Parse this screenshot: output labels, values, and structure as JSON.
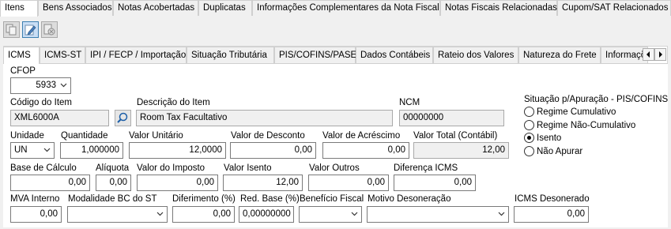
{
  "top_tabs": [
    {
      "label": "Itens",
      "active": true
    },
    {
      "label": "Bens Associados"
    },
    {
      "label": "Notas Acobertadas"
    },
    {
      "label": "Duplicatas"
    },
    {
      "label": "Informações Complementares da Nota Fiscal"
    },
    {
      "label": "Notas Fiscais Relacionadas"
    },
    {
      "label": "Cupom/SAT Relacionados"
    }
  ],
  "toolbar": {
    "buttons": [
      "copy-icon",
      "edit-icon",
      "delete-icon"
    ]
  },
  "inner_tabs": [
    {
      "label": "ICMS",
      "active": true
    },
    {
      "label": "ICMS-ST"
    },
    {
      "label": "IPI / FECP / Importação"
    },
    {
      "label": "Situação Tributária"
    },
    {
      "label": "PIS/COFINS/PASEP"
    },
    {
      "label": "Dados Contábeis"
    },
    {
      "label": "Rateio dos Valores"
    },
    {
      "label": "Natureza do Frete"
    },
    {
      "label": "Informações"
    }
  ],
  "form": {
    "cfop": {
      "label": "CFOP",
      "value": "5933"
    },
    "codigo_item": {
      "label": "Código do Item",
      "value": "XML6000A"
    },
    "descricao_item": {
      "label": "Descrição do Item",
      "value": "Room Tax Facultativo"
    },
    "ncm": {
      "label": "NCM",
      "value": "00000000"
    },
    "unidade": {
      "label": "Unidade",
      "value": "UN"
    },
    "quantidade": {
      "label": "Quantidade",
      "value": "1,000000"
    },
    "valor_unitario": {
      "label": "Valor Unitário",
      "value": "12,0000"
    },
    "valor_desconto": {
      "label": "Valor de Desconto",
      "value": "0,00"
    },
    "valor_acrescimo": {
      "label": "Valor de Acréscimo",
      "value": "0,00"
    },
    "valor_total": {
      "label": "Valor Total (Contábil)",
      "value": "12,00"
    },
    "base_calculo": {
      "label": "Base de Cálculo",
      "value": "0,00"
    },
    "aliquota": {
      "label": "Alíquota",
      "value": "0,00"
    },
    "valor_imposto": {
      "label": "Valor do Imposto",
      "value": "0,00"
    },
    "valor_isento": {
      "label": "Valor Isento",
      "value": "12,00"
    },
    "valor_outros": {
      "label": "Valor Outros",
      "value": "0,00"
    },
    "diferenca_icms": {
      "label": "Diferença ICMS",
      "value": "0,00"
    },
    "mva_interno": {
      "label": "MVA Interno",
      "value": "0,00"
    },
    "modalidade_bc": {
      "label": "Modalidade BC do ST",
      "value": ""
    },
    "diferimento": {
      "label": "Diferimento (%)",
      "value": "0,00"
    },
    "red_base": {
      "label": "Red. Base (%)",
      "value": "0,00000000"
    },
    "beneficio_fiscal": {
      "label": "Benefício Fiscal",
      "value": ""
    },
    "motivo_desoneracao": {
      "label": "Motivo Desoneração",
      "value": ""
    },
    "icms_desonerado": {
      "label": "ICMS Desonerado",
      "value": "0,00"
    }
  },
  "situacao": {
    "title": "Situação p/Apuração - PIS/COFINS",
    "options": [
      {
        "label": "Regime Cumulativo",
        "checked": false
      },
      {
        "label": "Regime Não-Cumulativo",
        "checked": false
      },
      {
        "label": "Isento",
        "checked": true
      },
      {
        "label": "Não Apurar",
        "checked": false
      }
    ]
  }
}
